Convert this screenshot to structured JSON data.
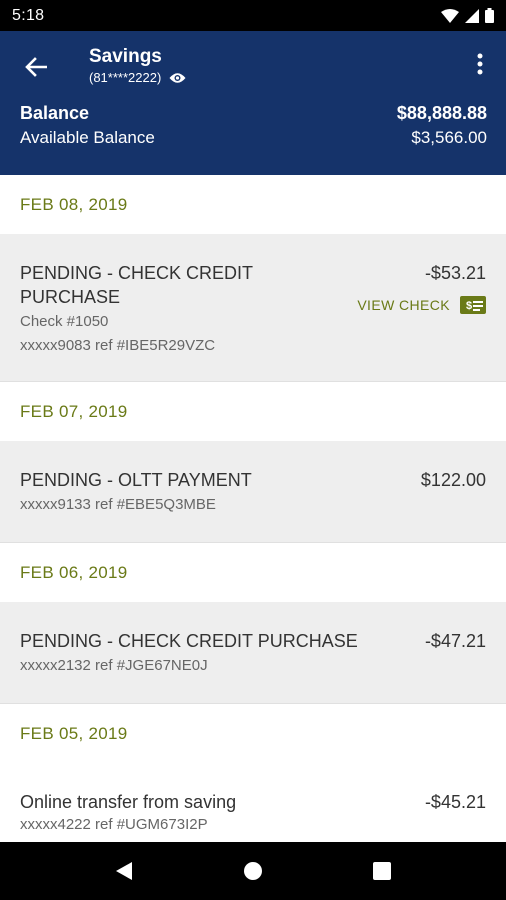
{
  "status_bar": {
    "time": "5:18",
    "icons": [
      "wifi-icon",
      "cell-signal-icon",
      "battery-icon"
    ]
  },
  "header": {
    "title": "Savings",
    "account_number": "(81****2222)",
    "balance_label": "Balance",
    "balance_value": "$88,888.88",
    "available_label": "Available Balance",
    "available_value": "$3,566.00",
    "background_color": "#15336a"
  },
  "accent_color": "#6a7a17",
  "transactions": [
    {
      "date": "FEB 08, 2019",
      "desc_line1": "PENDING - CHECK CREDIT",
      "desc_line2": "PURCHASE",
      "amount": "-$53.21",
      "check": "Check #1050",
      "ref": "xxxxx9083 ref #IBE5R29VZC",
      "action_label": "VIEW CHECK"
    },
    {
      "date": "FEB 07, 2019",
      "desc": "PENDING - OLTT PAYMENT",
      "amount": "$122.00",
      "ref": "xxxxx9133 ref #EBE5Q3MBE"
    },
    {
      "date": "FEB 06, 2019",
      "desc": "PENDING - CHECK CREDIT PURCHASE",
      "amount": "-$47.21",
      "ref": "xxxxx2132 ref #JGE67NE0J"
    },
    {
      "date": "FEB 05, 2019",
      "desc": "Online transfer from saving",
      "amount": "-$45.21",
      "ref": "xxxxx4222 ref #UGM673I2P"
    }
  ],
  "nav_bar": [
    "back-triangle-icon",
    "home-circle-icon",
    "recents-square-icon"
  ]
}
